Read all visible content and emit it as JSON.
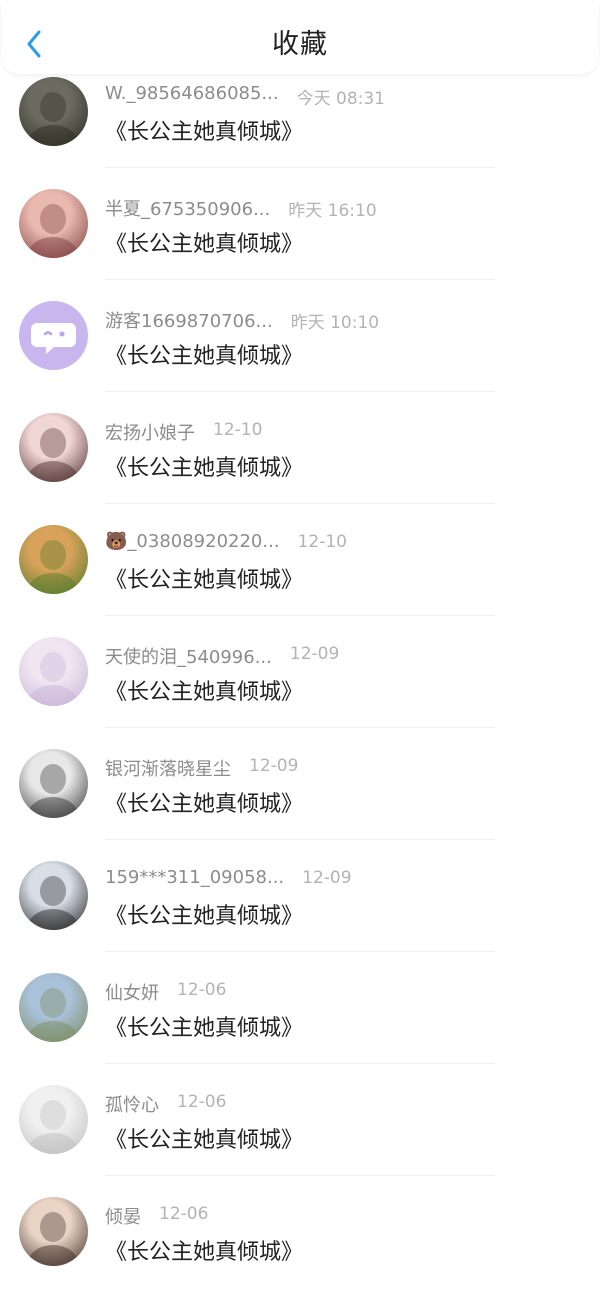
{
  "header": {
    "title": "收藏"
  },
  "items": [
    {
      "name": "W._98564686085...",
      "time": "今天 08:31",
      "book": "《长公主她真倾城》",
      "avatar_colors": [
        "#6b6b5f",
        "#2a2a22"
      ]
    },
    {
      "name": "半夏_675350906...",
      "time": "昨天 16:10",
      "book": "《长公主她真倾城》",
      "avatar_colors": [
        "#e9b9b0",
        "#7a3b3b"
      ]
    },
    {
      "name": "游客1669870706...",
      "time": "昨天 10:10",
      "book": "《长公主她真倾城》",
      "avatar_colors": [
        "#c9b6ef",
        "#c9b6ef"
      ]
    },
    {
      "name": "宏扬小娘子",
      "time": "12-10",
      "book": "《长公主她真倾城》",
      "avatar_colors": [
        "#f1d6d6",
        "#4a2a2a"
      ]
    },
    {
      "name": "🐻_03808920220...",
      "time": "12-10",
      "book": "《长公主她真倾城》",
      "avatar_colors": [
        "#d9a25a",
        "#4d7a2a"
      ]
    },
    {
      "name": "天使的泪_540996...",
      "time": "12-09",
      "book": "《长公主她真倾城》",
      "avatar_colors": [
        "#efe6f2",
        "#c8b2d6"
      ]
    },
    {
      "name": "银河渐落晓星尘",
      "time": "12-09",
      "book": "《长公主她真倾城》",
      "avatar_colors": [
        "#e8e8e8",
        "#2f2f2f"
      ]
    },
    {
      "name": "159***311_09058...",
      "time": "12-09",
      "book": "《长公主她真倾城》",
      "avatar_colors": [
        "#d8dde6",
        "#1f1f1f"
      ]
    },
    {
      "name": "仙女妍",
      "time": "12-06",
      "book": "《长公主她真倾城》",
      "avatar_colors": [
        "#a9c1d9",
        "#7a8a5a"
      ]
    },
    {
      "name": "孤怜心",
      "time": "12-06",
      "book": "《长公主她真倾城》",
      "avatar_colors": [
        "#f0f0f0",
        "#bdbdbd"
      ]
    },
    {
      "name": "倾晏",
      "time": "12-06",
      "book": "《长公主她真倾城》",
      "avatar_colors": [
        "#e9d4c6",
        "#3b2a22"
      ]
    }
  ]
}
